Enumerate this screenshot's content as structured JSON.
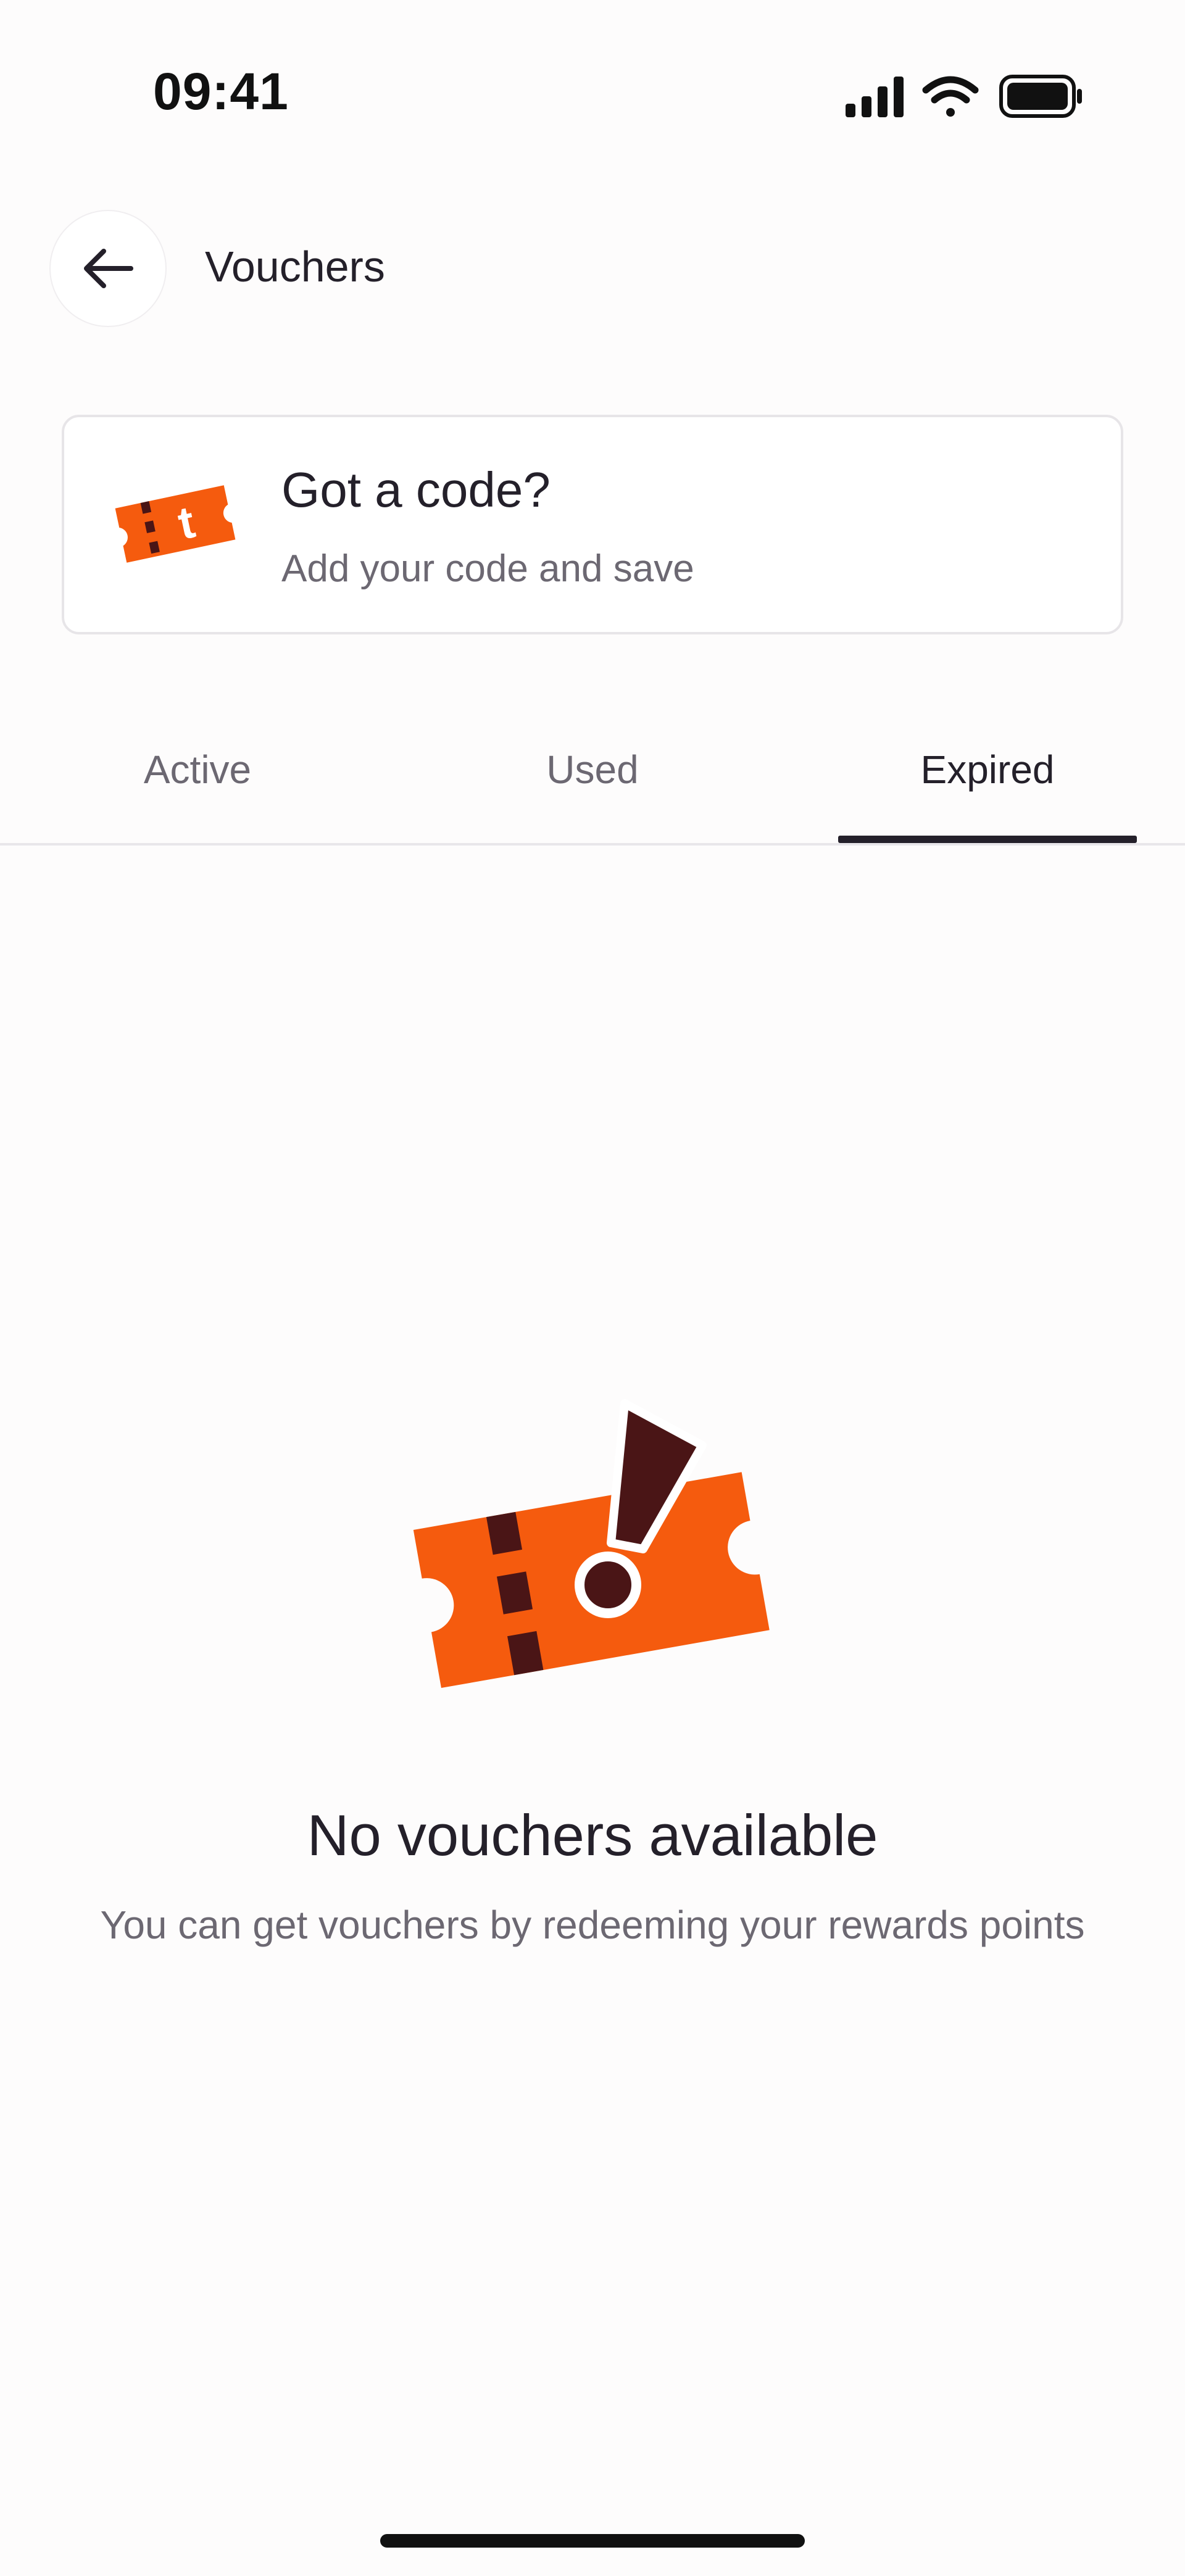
{
  "status_bar": {
    "time": "09:41",
    "icons": [
      "signal-icon",
      "wifi-icon",
      "battery-icon"
    ]
  },
  "header": {
    "title": "Vouchers",
    "back_icon": "arrow-left-icon"
  },
  "code_card": {
    "title": "Got a code?",
    "subtitle": "Add your code and save",
    "icon": "ticket-icon"
  },
  "tabs": [
    {
      "label": "Active",
      "selected": false
    },
    {
      "label": "Used",
      "selected": false
    },
    {
      "label": "Expired",
      "selected": true
    }
  ],
  "empty_state": {
    "title": "No vouchers available",
    "subtitle": "You can get vouchers by redeeming your rewards points",
    "icon": "ticket-exclamation-icon"
  },
  "colors": {
    "accent": "#F55B0E",
    "ticket_dark": "#4A1516",
    "text_primary": "#24202A",
    "text_secondary": "#6C6872",
    "background": "#FDFCFC"
  }
}
